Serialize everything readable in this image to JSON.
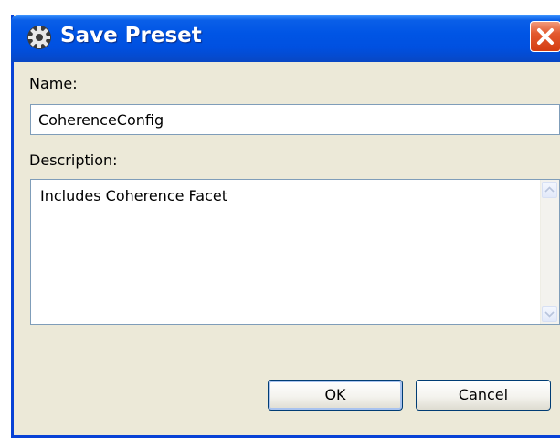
{
  "window": {
    "title": "Save Preset"
  },
  "form": {
    "name_label": "Name:",
    "name_value": "CoherenceConfig",
    "description_label": "Description:",
    "description_value": "Includes Coherence Facet"
  },
  "buttons": {
    "ok_label": "OK",
    "cancel_label": "Cancel"
  },
  "icons": {
    "app": "gear-icon",
    "close": "close-icon",
    "scroll_up": "arrow-up-icon",
    "scroll_down": "arrow-down-icon"
  },
  "colors": {
    "titlebar": "#0055e5",
    "dialog_bg": "#ece9d8",
    "close_button": "#d43d12",
    "field_border": "#7f9db9"
  }
}
